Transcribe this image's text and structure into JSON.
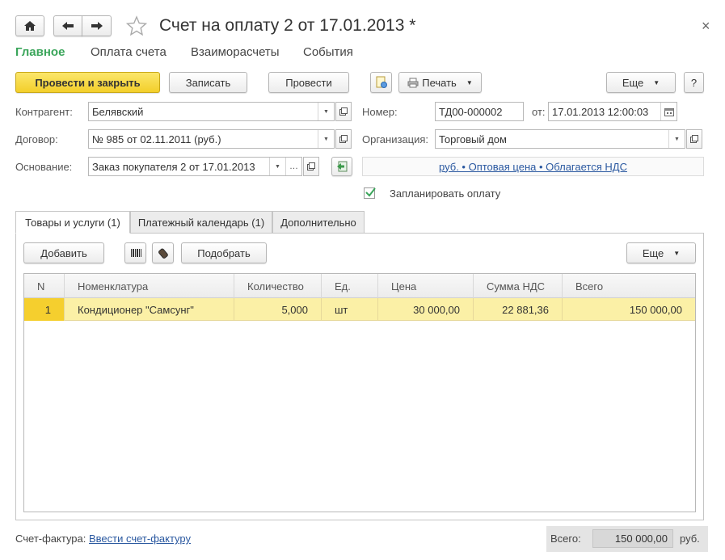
{
  "window": {
    "title": "Счет на оплату 2 от 17.01.2013 *"
  },
  "nav": {
    "items": [
      "Главное",
      "Оплата счета",
      "Взаиморасчеты",
      "События"
    ]
  },
  "toolbar": {
    "post_close": "Провести и закрыть",
    "save": "Записать",
    "post": "Провести",
    "print": "Печать",
    "more": "Еще",
    "help": "?"
  },
  "form": {
    "counterparty_label": "Контрагент:",
    "counterparty_value": "Белявский",
    "contract_label": "Договор:",
    "contract_value": "№ 985 от 02.11.2011 (руб.)",
    "basis_label": "Основание:",
    "basis_value": "Заказ покупателя 2 от 17.01.2013",
    "number_label": "Номер:",
    "number_value": "ТД00-000002",
    "date_label": "от:",
    "date_value": "17.01.2013 12:00:03",
    "org_label": "Организация:",
    "org_value": "Торговый дом",
    "price_info_link": "руб. • Оптовая цена • Облагается НДС",
    "plan_payment_label": "Запланировать оплату",
    "plan_payment_checked": true
  },
  "tabs": [
    "Товары и услуги (1)",
    "Платежный календарь (1)",
    "Дополнительно"
  ],
  "table_toolbar": {
    "add": "Добавить",
    "pick": "Подобрать",
    "more": "Еще"
  },
  "table": {
    "columns": [
      "N",
      "Номенклатура",
      "Количество",
      "Ед.",
      "Цена",
      "Сумма НДС",
      "Всего"
    ],
    "rows": [
      [
        "1",
        "Кондиционер \"Самсунг\"",
        "5,000",
        "шт",
        "30 000,00",
        "22 881,36",
        "150 000,00"
      ]
    ]
  },
  "footer": {
    "invoice_label": "Счет-фактура:",
    "invoice_link": "Ввести счет-фактуру",
    "total_label": "Всего:",
    "total_value": "150 000,00",
    "currency": "руб."
  },
  "colors": {
    "accent_green": "#3aa55a",
    "primary_button": "#f3cf2a",
    "selected_row": "#fbf0a6",
    "link": "#2a58a0"
  }
}
